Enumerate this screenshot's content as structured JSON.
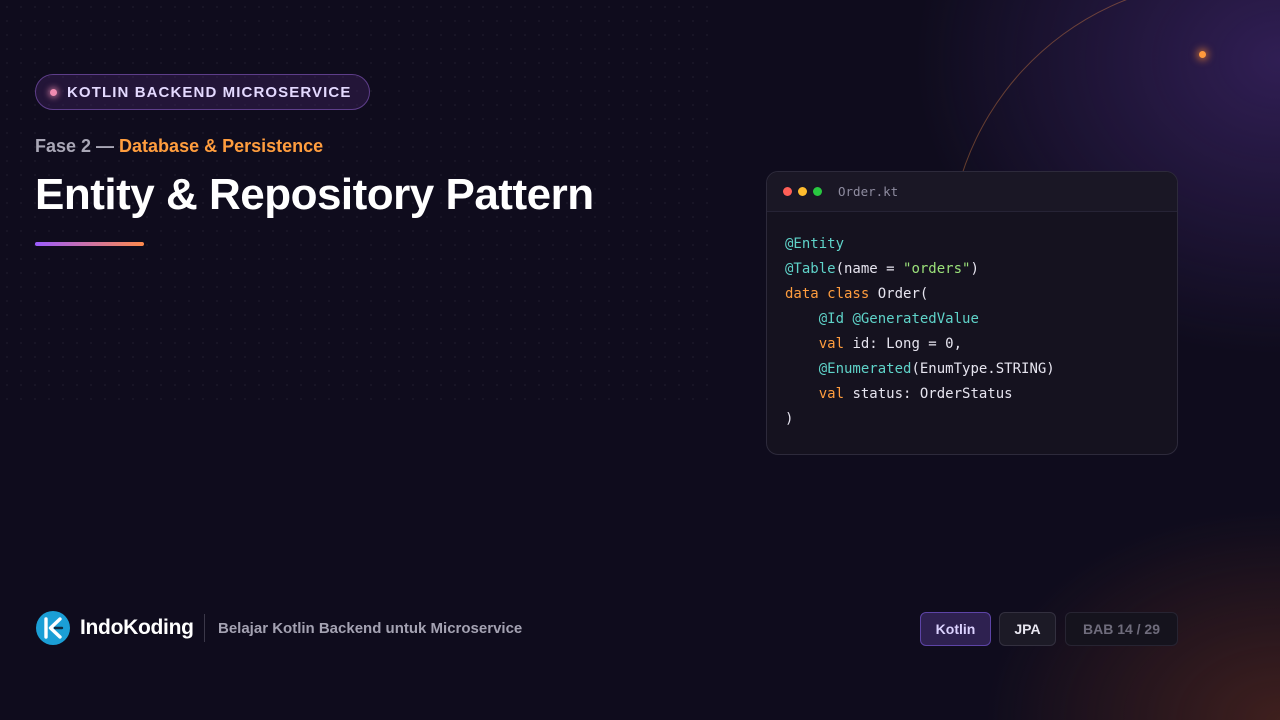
{
  "series_badge": {
    "label": "KOTLIN BACKEND MICROSERVICE"
  },
  "phase": {
    "prefix": "Fase 2 — ",
    "topic": "Database & Persistence"
  },
  "slide": {
    "title": "Entity & Repository Pattern"
  },
  "editor": {
    "filename": "Order.kt",
    "code_lines": [
      [
        {
          "t": "@Entity",
          "c": "ann"
        }
      ],
      [
        {
          "t": "@Table",
          "c": "ann"
        },
        {
          "t": "(name = ",
          "c": "def"
        },
        {
          "t": "\"orders\"",
          "c": "str"
        },
        {
          "t": ")",
          "c": "def"
        }
      ],
      [
        {
          "t": "data class",
          "c": "kw"
        },
        {
          "t": " Order(",
          "c": "def"
        }
      ],
      [
        {
          "t": "    ",
          "c": "def"
        },
        {
          "t": "@Id",
          "c": "ann"
        },
        {
          "t": " ",
          "c": "def"
        },
        {
          "t": "@GeneratedValue",
          "c": "ann"
        }
      ],
      [
        {
          "t": "    ",
          "c": "def"
        },
        {
          "t": "val",
          "c": "kw"
        },
        {
          "t": " id: Long = 0,",
          "c": "def"
        }
      ],
      [
        {
          "t": "    ",
          "c": "def"
        },
        {
          "t": "@Enumerated",
          "c": "ann"
        },
        {
          "t": "(EnumType.STRING)",
          "c": "def"
        }
      ],
      [
        {
          "t": "    ",
          "c": "def"
        },
        {
          "t": "val",
          "c": "kw"
        },
        {
          "t": " status: OrderStatus",
          "c": "def"
        }
      ],
      [
        {
          "t": ")",
          "c": "def"
        }
      ]
    ]
  },
  "footer": {
    "brand": "IndoKoding",
    "tagline": "Belajar Kotlin Backend untuk Microservice",
    "tags": [
      "Kotlin",
      "JPA"
    ],
    "chapter": "BAB 14 / 29"
  },
  "colors": {
    "accent_orange": "#ff9d3e",
    "accent_purple": "#9b5cff",
    "background": "#0f0c1d",
    "code_annotation": "#5fd3c9",
    "code_string": "#9be17a"
  }
}
